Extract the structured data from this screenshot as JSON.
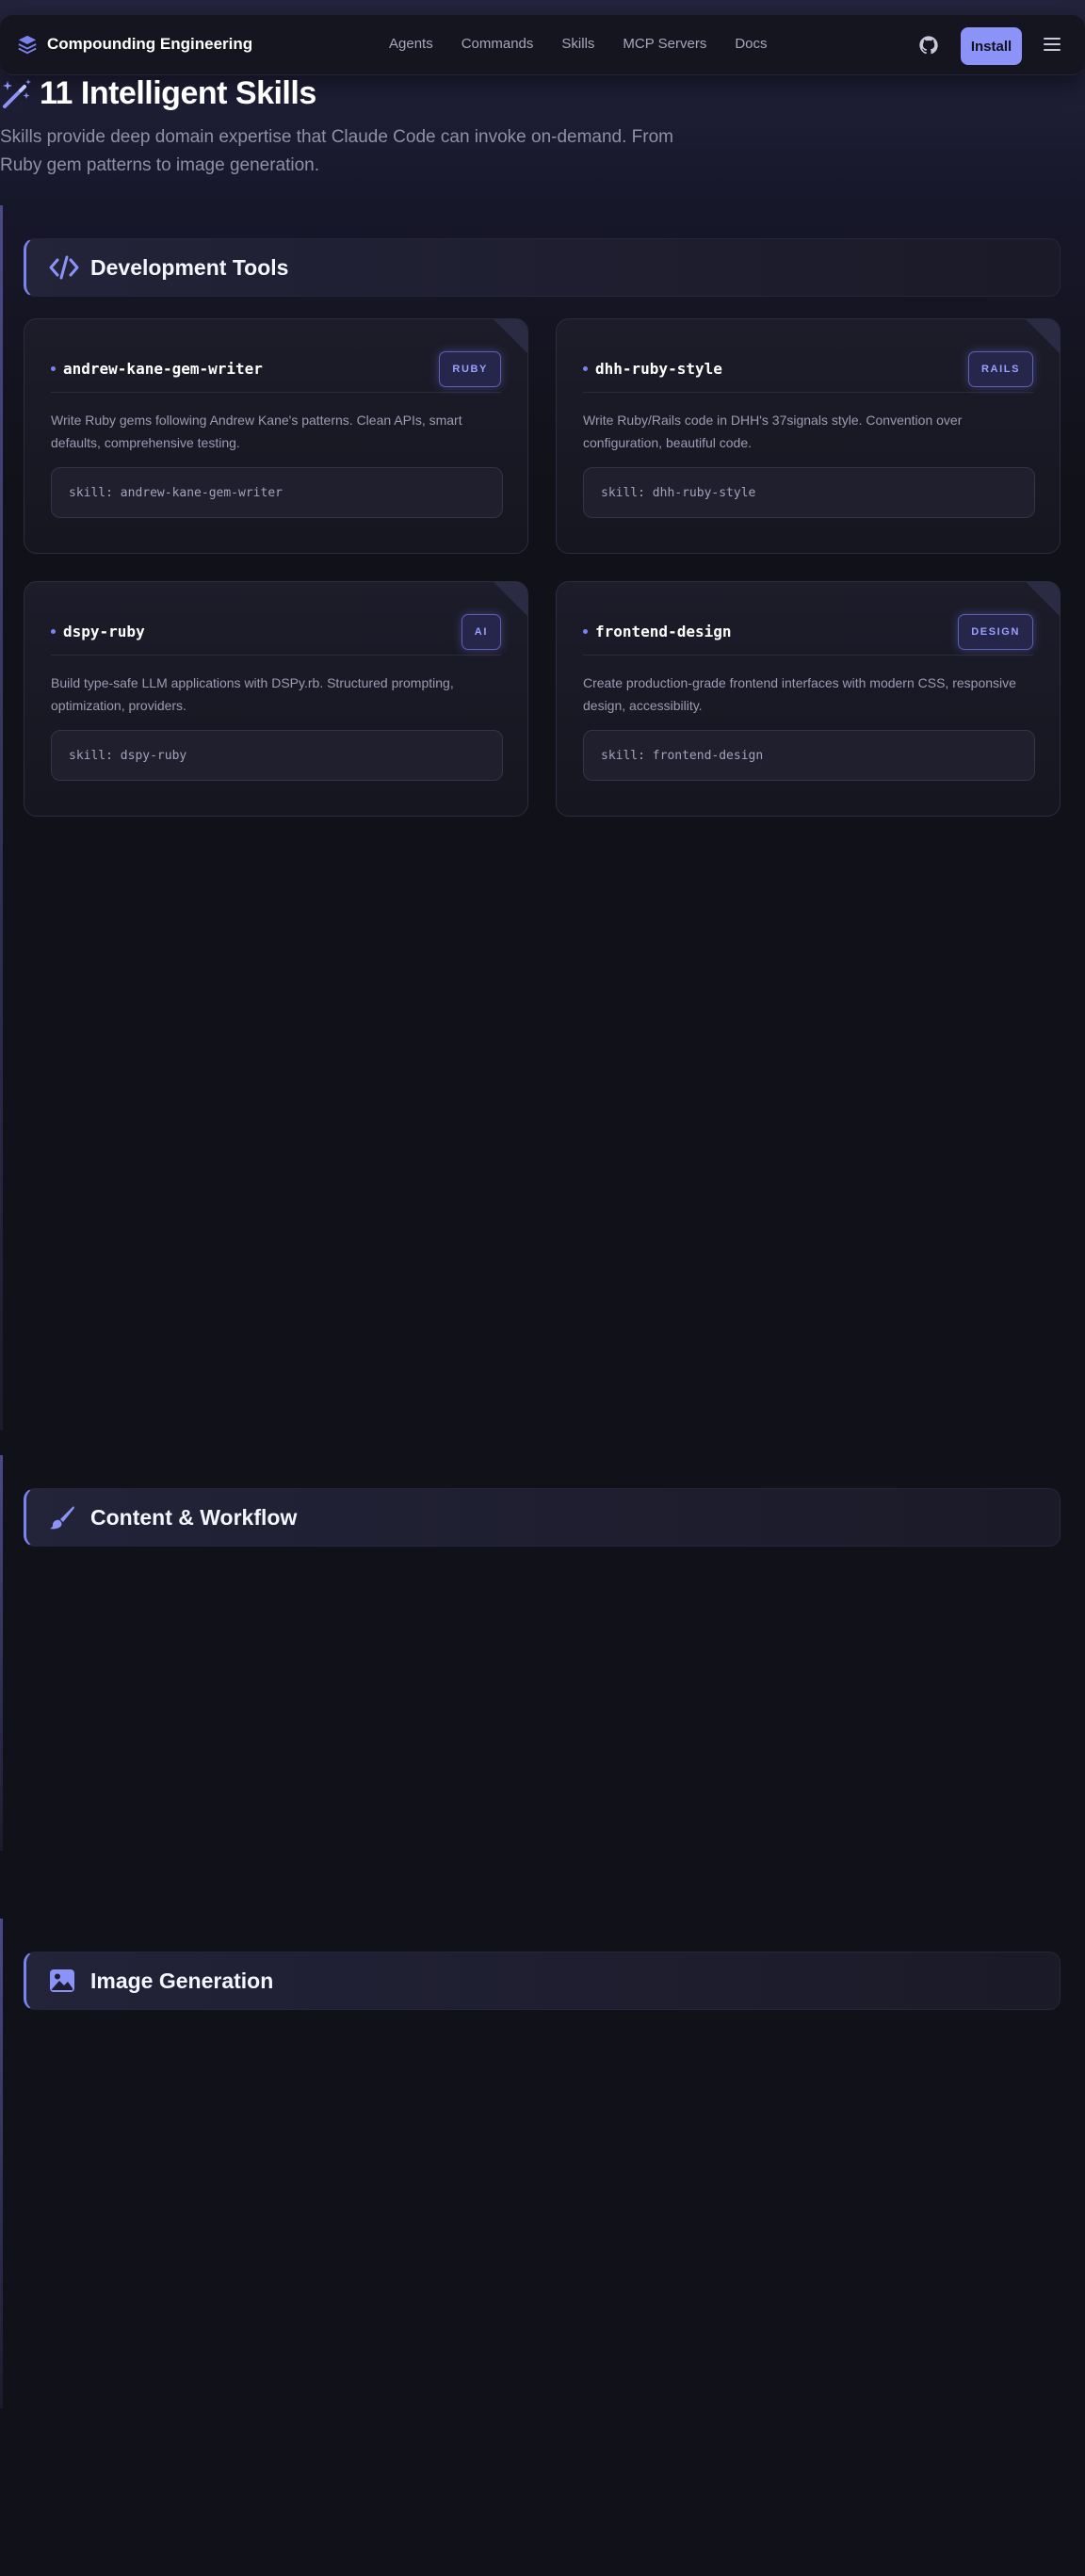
{
  "nav": {
    "brand": "Compounding Engineering",
    "links": [
      "Agents",
      "Commands",
      "Skills",
      "MCP Servers",
      "Docs"
    ],
    "install_label": "Install"
  },
  "hero": {
    "title": "11 Intelligent Skills",
    "subtitle": "Skills provide deep domain expertise that Claude Code can invoke on-demand. From Ruby gem patterns to image generation."
  },
  "sections": [
    {
      "title": "Development Tools",
      "icon": "code-icon",
      "cards": [
        {
          "name": "andrew-kane-gem-writer",
          "badge": "RUBY",
          "description": "Write Ruby gems following Andrew Kane's patterns. Clean APIs, smart defaults, comprehensive testing.",
          "command": "skill: andrew-kane-gem-writer"
        },
        {
          "name": "dhh-ruby-style",
          "badge": "RAILS",
          "description": "Write Ruby/Rails code in DHH's 37signals style. Convention over configuration, beautiful code.",
          "command": "skill: dhh-ruby-style"
        },
        {
          "name": "dspy-ruby",
          "badge": "AI",
          "description": "Build type-safe LLM applications with DSPy.rb. Structured prompting, optimization, providers.",
          "command": "skill: dspy-ruby"
        },
        {
          "name": "frontend-design",
          "badge": "DESIGN",
          "description": "Create production-grade frontend interfaces with modern CSS, responsive design, accessibility.",
          "command": "skill: frontend-design"
        }
      ]
    },
    {
      "title": "Content & Workflow",
      "icon": "paintbrush-icon",
      "cards": []
    },
    {
      "title": "Image Generation",
      "icon": "image-icon",
      "cards": []
    }
  ],
  "colors": {
    "accent": "#7c83f0",
    "install_button": "#8b93f8",
    "background": "#111119"
  }
}
